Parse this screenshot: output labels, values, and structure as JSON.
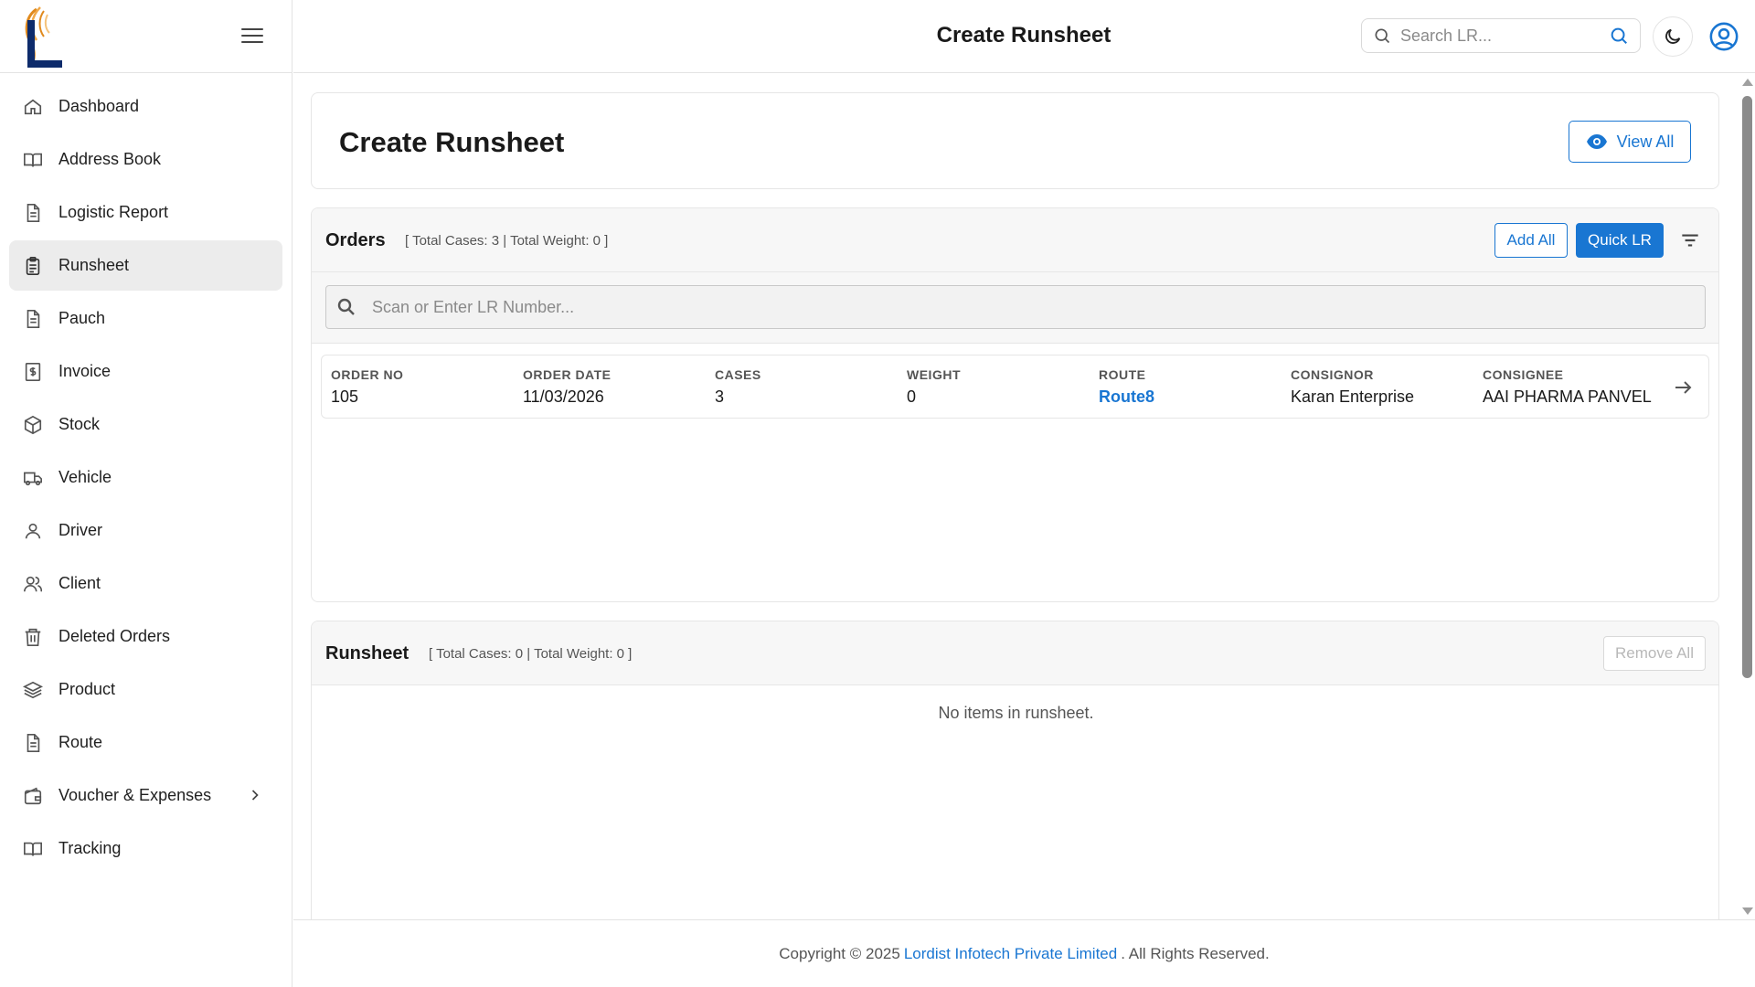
{
  "app": {
    "page_title": "Create Runsheet"
  },
  "sidebar": {
    "items": [
      {
        "label": "Dashboard",
        "icon": "home-icon"
      },
      {
        "label": "Address Book",
        "icon": "book-icon"
      },
      {
        "label": "Logistic Report",
        "icon": "document-icon"
      },
      {
        "label": "Runsheet",
        "icon": "clipboard-icon",
        "active": true
      },
      {
        "label": "Pauch",
        "icon": "document-icon"
      },
      {
        "label": "Invoice",
        "icon": "invoice-dollar-icon"
      },
      {
        "label": "Stock",
        "icon": "box-icon"
      },
      {
        "label": "Vehicle",
        "icon": "truck-icon"
      },
      {
        "label": "Driver",
        "icon": "user-icon"
      },
      {
        "label": "Client",
        "icon": "users-icon"
      },
      {
        "label": "Deleted Orders",
        "icon": "trash-icon"
      },
      {
        "label": "Product",
        "icon": "layers-icon"
      },
      {
        "label": "Route",
        "icon": "document-icon"
      },
      {
        "label": "Voucher & Expenses",
        "icon": "wallet-icon",
        "has_submenu": true
      },
      {
        "label": "Tracking",
        "icon": "book-icon"
      }
    ]
  },
  "topbar": {
    "title": "Create Runsheet",
    "search_placeholder": "Search LR..."
  },
  "header_card": {
    "title": "Create Runsheet",
    "view_all_label": "View All"
  },
  "orders": {
    "title": "Orders",
    "summary": "[ Total Cases: 3 | Total Weight: 0 ]",
    "add_all_label": "Add All",
    "quick_lr_label": "Quick LR",
    "scan_placeholder": "Scan or Enter LR Number...",
    "columns": [
      "ORDER NO",
      "ORDER DATE",
      "CASES",
      "WEIGHT",
      "ROUTE",
      "CONSIGNOR",
      "CONSIGNEE"
    ],
    "rows": [
      {
        "order_no": "105",
        "order_date": "11/03/2026",
        "cases": "3",
        "weight": "0",
        "route": "Route8",
        "consignor": "Karan Enterprise",
        "consignee": "AAI PHARMA PANVEL"
      }
    ]
  },
  "runsheet": {
    "title": "Runsheet",
    "summary": "[ Total Cases: 0 | Total Weight: 0 ]",
    "remove_all_label": "Remove All",
    "empty_message": "No items in runsheet."
  },
  "footer": {
    "prefix": "Copyright © 2025",
    "company": "Lordist Infotech Private Limited",
    "suffix": ". All Rights Reserved."
  },
  "colors": {
    "primary": "#1976d2",
    "active_nav_bg": "#ececec",
    "logo_blue": "#0d2b6b",
    "logo_orange": "#e08a1e"
  }
}
